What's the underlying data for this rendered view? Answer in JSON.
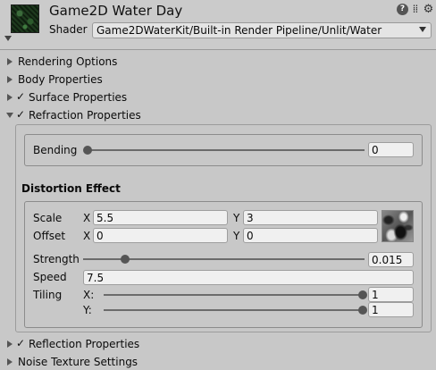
{
  "header": {
    "material_name": "Game2D Water Day",
    "shader_label": "Shader",
    "shader_value": "Game2DWaterKit/Built-in Render Pipeline/Unlit/Water",
    "help_glyph": "?"
  },
  "foldouts": {
    "rendering_options": "Rendering Options",
    "body_properties": "Body Properties",
    "surface_properties": "Surface Properties",
    "refraction_properties": "Refraction Properties",
    "reflection_properties": "Reflection Properties",
    "noise_texture_settings": "Noise Texture Settings"
  },
  "refraction": {
    "bending_label": "Bending",
    "bending_value": "0",
    "bending_slider": 0.0,
    "distortion_title": "Distortion Effect",
    "scale_label": "Scale",
    "scale_x_label": "X",
    "scale_x": "5.5",
    "scale_y_label": "Y",
    "scale_y": "3",
    "offset_label": "Offset",
    "offset_x_label": "X",
    "offset_x": "0",
    "offset_y_label": "Y",
    "offset_y": "0",
    "strength_label": "Strength",
    "strength_value": "0.015",
    "strength_slider": 0.15,
    "speed_label": "Speed",
    "speed_value": "7.5",
    "tiling_label": "Tiling",
    "tiling_x_label": "X:",
    "tiling_x_value": "1",
    "tiling_x_slider": 1.0,
    "tiling_y_label": "Y:",
    "tiling_y_value": "1",
    "tiling_y_slider": 1.0
  },
  "icons": {
    "check": "✓",
    "preset": "⁞⁞",
    "settings": "⚙"
  }
}
